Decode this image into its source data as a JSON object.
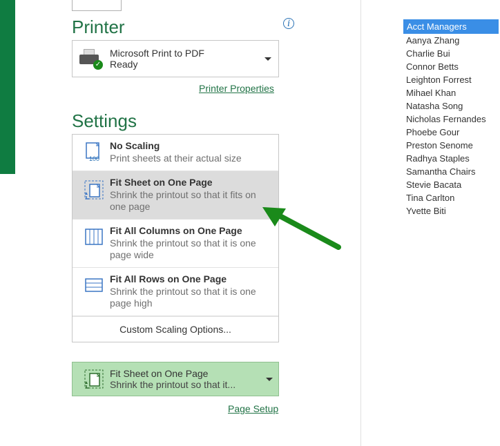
{
  "sections": {
    "printer": "Printer",
    "settings": "Settings"
  },
  "printer": {
    "name": "Microsoft Print to PDF",
    "status": "Ready",
    "properties_link": "Printer Properties"
  },
  "scaling_options": [
    {
      "title": "No Scaling",
      "desc": "Print sheets at their actual size"
    },
    {
      "title": "Fit Sheet on One Page",
      "desc": "Shrink the printout so that it fits on one page"
    },
    {
      "title": "Fit All Columns on One Page",
      "desc": "Shrink the printout so that it is one page wide"
    },
    {
      "title": "Fit All Rows on One Page",
      "desc": "Shrink the printout so that it is one page high"
    }
  ],
  "custom_option": "Custom Scaling Options...",
  "selected": {
    "title": "Fit Sheet on One Page",
    "desc": "Shrink the printout so that it..."
  },
  "links": {
    "page_setup": "Page Setup"
  },
  "preview": {
    "header": "Acct Managers",
    "rows": [
      "Aanya Zhang",
      "Charlie Bui",
      "Connor Betts",
      "Leighton Forrest",
      "Mihael Khan",
      "Natasha Song",
      "Nicholas Fernandes",
      "Phoebe Gour",
      "Preston Senome",
      "Radhya Staples",
      "Samantha Chairs",
      "Stevie Bacata",
      "Tina Carlton",
      "Yvette Biti"
    ]
  },
  "colors": {
    "excel_green": "#217346",
    "highlight_gray": "#dcdcdc",
    "selected_green": "#b5e0b5",
    "preview_blue": "#3a8ee6",
    "arrow_green": "#1a8a1a"
  }
}
